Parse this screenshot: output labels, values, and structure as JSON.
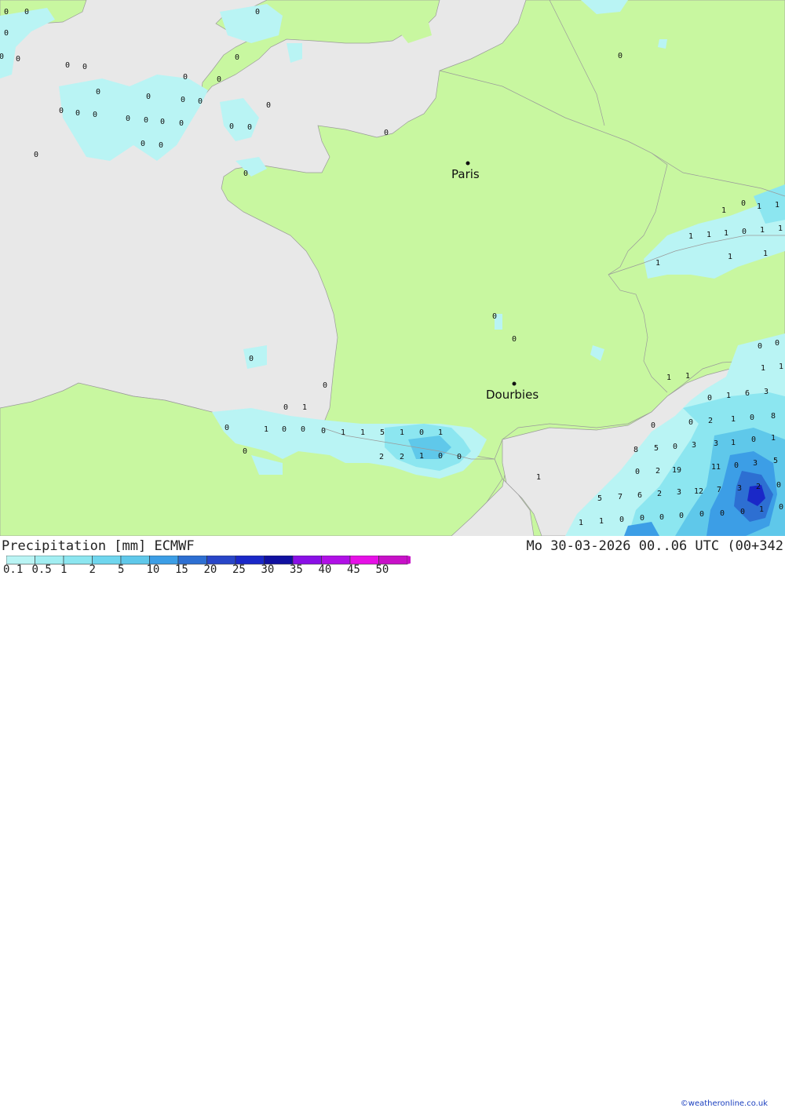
{
  "colors": {
    "sea": "#e8e8e8",
    "land": "#c8f7a0",
    "precip_0_1": "#b9f4f4",
    "precip_1": "#8ce6f0",
    "precip_2": "#5fc8ea",
    "precip_5": "#3c9ee6",
    "precip_10": "#2d6fd2",
    "precip_20": "#1a28c8"
  },
  "map": {
    "cities": [
      {
        "name": "Paris",
        "marker": "dot"
      },
      {
        "name": "Dourbies",
        "marker": "dot"
      }
    ],
    "values": [
      "0",
      "0",
      "0",
      "0",
      "0",
      "0",
      "0",
      "0",
      "0",
      "0",
      "0",
      "0",
      "0",
      "0",
      "0",
      "0",
      "0",
      "0",
      "0",
      "0",
      "0",
      "0",
      "0",
      "0",
      "0",
      "0",
      "0",
      "0",
      "0",
      "0",
      "0",
      "0",
      "0",
      "0",
      "1",
      "0",
      "1",
      "0",
      "0",
      "0",
      "1",
      "1",
      "5",
      "1",
      "0",
      "1",
      "2",
      "2",
      "1",
      "0",
      "0",
      "0",
      "0",
      "0",
      "1",
      "1",
      "0",
      "1",
      "1",
      "1",
      "1",
      "1",
      "0",
      "1",
      "1",
      "1",
      "1",
      "1",
      "0",
      "0",
      "1",
      "1",
      "1",
      "1",
      "0",
      "1",
      "6",
      "3",
      "0",
      "0",
      "2",
      "1",
      "0",
      "8",
      "8",
      "5",
      "0",
      "3",
      "3",
      "1",
      "0",
      "1",
      "0",
      "2",
      "19",
      "11",
      "0",
      "3",
      "5",
      "5",
      "7",
      "6",
      "2",
      "3",
      "12",
      "7",
      "3",
      "2",
      "0",
      "1",
      "1",
      "0",
      "0",
      "0",
      "0",
      "0",
      "0",
      "0",
      "1",
      "0",
      "0",
      "0"
    ]
  },
  "footer": {
    "title": "Precipitation [mm] ECMWF",
    "datetime": "Mo 30-03-2026 00..06 UTC (00+342",
    "credit": "©weatheronline.co.uk",
    "scale_labels": [
      "0.1",
      "0.5",
      "1",
      "2",
      "5",
      "10",
      "15",
      "20",
      "25",
      "30",
      "35",
      "40",
      "45",
      "50"
    ],
    "scale_colors": [
      "#b9f4f4",
      "#a2eef2",
      "#8ce6f0",
      "#6fd6ee",
      "#5fc8ea",
      "#3c9ee6",
      "#2d6fd2",
      "#2846c8",
      "#1a28c8",
      "#1010a0",
      "#8a10e6",
      "#b010e6",
      "#e610e6",
      "#c810c8"
    ]
  }
}
